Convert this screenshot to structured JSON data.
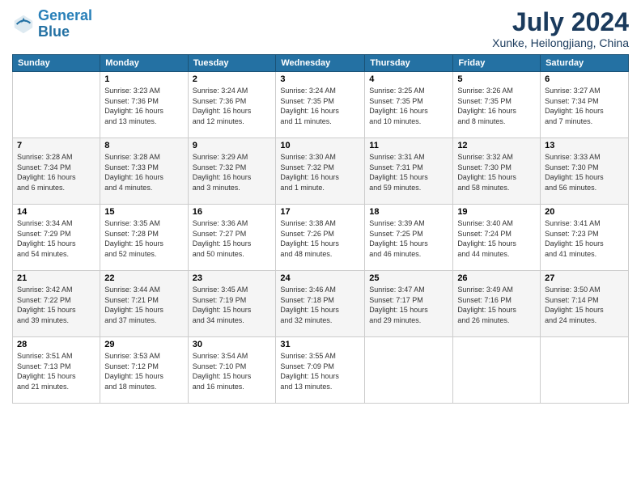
{
  "header": {
    "logo_line1": "General",
    "logo_line2": "Blue",
    "month_year": "July 2024",
    "location": "Xunke, Heilongjiang, China"
  },
  "weekdays": [
    "Sunday",
    "Monday",
    "Tuesday",
    "Wednesday",
    "Thursday",
    "Friday",
    "Saturday"
  ],
  "weeks": [
    [
      {
        "day": "",
        "info": ""
      },
      {
        "day": "1",
        "info": "Sunrise: 3:23 AM\nSunset: 7:36 PM\nDaylight: 16 hours\nand 13 minutes."
      },
      {
        "day": "2",
        "info": "Sunrise: 3:24 AM\nSunset: 7:36 PM\nDaylight: 16 hours\nand 12 minutes."
      },
      {
        "day": "3",
        "info": "Sunrise: 3:24 AM\nSunset: 7:35 PM\nDaylight: 16 hours\nand 11 minutes."
      },
      {
        "day": "4",
        "info": "Sunrise: 3:25 AM\nSunset: 7:35 PM\nDaylight: 16 hours\nand 10 minutes."
      },
      {
        "day": "5",
        "info": "Sunrise: 3:26 AM\nSunset: 7:35 PM\nDaylight: 16 hours\nand 8 minutes."
      },
      {
        "day": "6",
        "info": "Sunrise: 3:27 AM\nSunset: 7:34 PM\nDaylight: 16 hours\nand 7 minutes."
      }
    ],
    [
      {
        "day": "7",
        "info": "Sunrise: 3:28 AM\nSunset: 7:34 PM\nDaylight: 16 hours\nand 6 minutes."
      },
      {
        "day": "8",
        "info": "Sunrise: 3:28 AM\nSunset: 7:33 PM\nDaylight: 16 hours\nand 4 minutes."
      },
      {
        "day": "9",
        "info": "Sunrise: 3:29 AM\nSunset: 7:32 PM\nDaylight: 16 hours\nand 3 minutes."
      },
      {
        "day": "10",
        "info": "Sunrise: 3:30 AM\nSunset: 7:32 PM\nDaylight: 16 hours\nand 1 minute."
      },
      {
        "day": "11",
        "info": "Sunrise: 3:31 AM\nSunset: 7:31 PM\nDaylight: 15 hours\nand 59 minutes."
      },
      {
        "day": "12",
        "info": "Sunrise: 3:32 AM\nSunset: 7:30 PM\nDaylight: 15 hours\nand 58 minutes."
      },
      {
        "day": "13",
        "info": "Sunrise: 3:33 AM\nSunset: 7:30 PM\nDaylight: 15 hours\nand 56 minutes."
      }
    ],
    [
      {
        "day": "14",
        "info": "Sunrise: 3:34 AM\nSunset: 7:29 PM\nDaylight: 15 hours\nand 54 minutes."
      },
      {
        "day": "15",
        "info": "Sunrise: 3:35 AM\nSunset: 7:28 PM\nDaylight: 15 hours\nand 52 minutes."
      },
      {
        "day": "16",
        "info": "Sunrise: 3:36 AM\nSunset: 7:27 PM\nDaylight: 15 hours\nand 50 minutes."
      },
      {
        "day": "17",
        "info": "Sunrise: 3:38 AM\nSunset: 7:26 PM\nDaylight: 15 hours\nand 48 minutes."
      },
      {
        "day": "18",
        "info": "Sunrise: 3:39 AM\nSunset: 7:25 PM\nDaylight: 15 hours\nand 46 minutes."
      },
      {
        "day": "19",
        "info": "Sunrise: 3:40 AM\nSunset: 7:24 PM\nDaylight: 15 hours\nand 44 minutes."
      },
      {
        "day": "20",
        "info": "Sunrise: 3:41 AM\nSunset: 7:23 PM\nDaylight: 15 hours\nand 41 minutes."
      }
    ],
    [
      {
        "day": "21",
        "info": "Sunrise: 3:42 AM\nSunset: 7:22 PM\nDaylight: 15 hours\nand 39 minutes."
      },
      {
        "day": "22",
        "info": "Sunrise: 3:44 AM\nSunset: 7:21 PM\nDaylight: 15 hours\nand 37 minutes."
      },
      {
        "day": "23",
        "info": "Sunrise: 3:45 AM\nSunset: 7:19 PM\nDaylight: 15 hours\nand 34 minutes."
      },
      {
        "day": "24",
        "info": "Sunrise: 3:46 AM\nSunset: 7:18 PM\nDaylight: 15 hours\nand 32 minutes."
      },
      {
        "day": "25",
        "info": "Sunrise: 3:47 AM\nSunset: 7:17 PM\nDaylight: 15 hours\nand 29 minutes."
      },
      {
        "day": "26",
        "info": "Sunrise: 3:49 AM\nSunset: 7:16 PM\nDaylight: 15 hours\nand 26 minutes."
      },
      {
        "day": "27",
        "info": "Sunrise: 3:50 AM\nSunset: 7:14 PM\nDaylight: 15 hours\nand 24 minutes."
      }
    ],
    [
      {
        "day": "28",
        "info": "Sunrise: 3:51 AM\nSunset: 7:13 PM\nDaylight: 15 hours\nand 21 minutes."
      },
      {
        "day": "29",
        "info": "Sunrise: 3:53 AM\nSunset: 7:12 PM\nDaylight: 15 hours\nand 18 minutes."
      },
      {
        "day": "30",
        "info": "Sunrise: 3:54 AM\nSunset: 7:10 PM\nDaylight: 15 hours\nand 16 minutes."
      },
      {
        "day": "31",
        "info": "Sunrise: 3:55 AM\nSunset: 7:09 PM\nDaylight: 15 hours\nand 13 minutes."
      },
      {
        "day": "",
        "info": ""
      },
      {
        "day": "",
        "info": ""
      },
      {
        "day": "",
        "info": ""
      }
    ]
  ]
}
